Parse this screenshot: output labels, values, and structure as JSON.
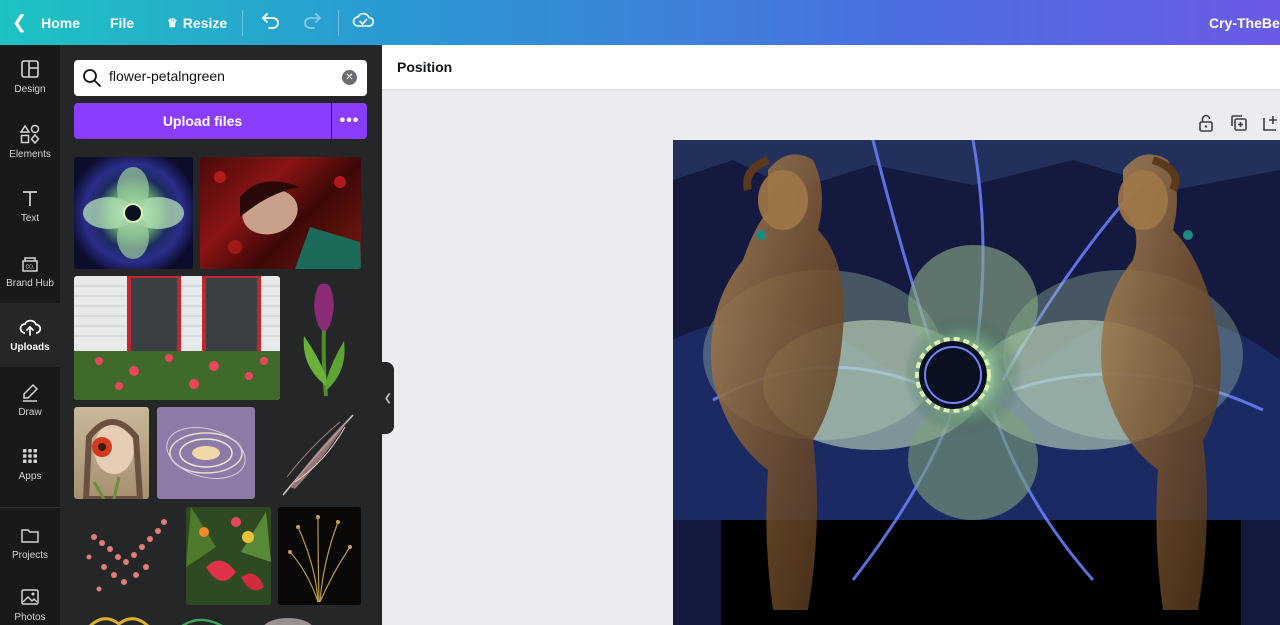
{
  "topbar": {
    "home_label": "Home",
    "file_label": "File",
    "resize_label": "Resize",
    "doc_title": "Cry-TheBelo"
  },
  "rail": {
    "items": [
      {
        "label": "Design",
        "icon": "layout-icon"
      },
      {
        "label": "Elements",
        "icon": "shapes-icon"
      },
      {
        "label": "Text",
        "icon": "text-icon"
      },
      {
        "label": "Brand Hub",
        "icon": "brand-hub-icon"
      },
      {
        "label": "Uploads",
        "icon": "cloud-upload-icon"
      },
      {
        "label": "Draw",
        "icon": "pen-icon"
      },
      {
        "label": "Apps",
        "icon": "apps-grid-icon"
      },
      {
        "label": "Projects",
        "icon": "folder-icon"
      },
      {
        "label": "Photos",
        "icon": "image-icon"
      }
    ],
    "active": "Uploads"
  },
  "panel": {
    "search_value": "flower-petalngreen",
    "upload_label": "Upload files",
    "more_label": "•••"
  },
  "context_bar": {
    "position_label": "Position"
  },
  "colors": {
    "accent": "#8b3dff",
    "rail_bg": "#18191b",
    "panel_bg": "#252627",
    "canvas_bg": "#ebecf0"
  }
}
